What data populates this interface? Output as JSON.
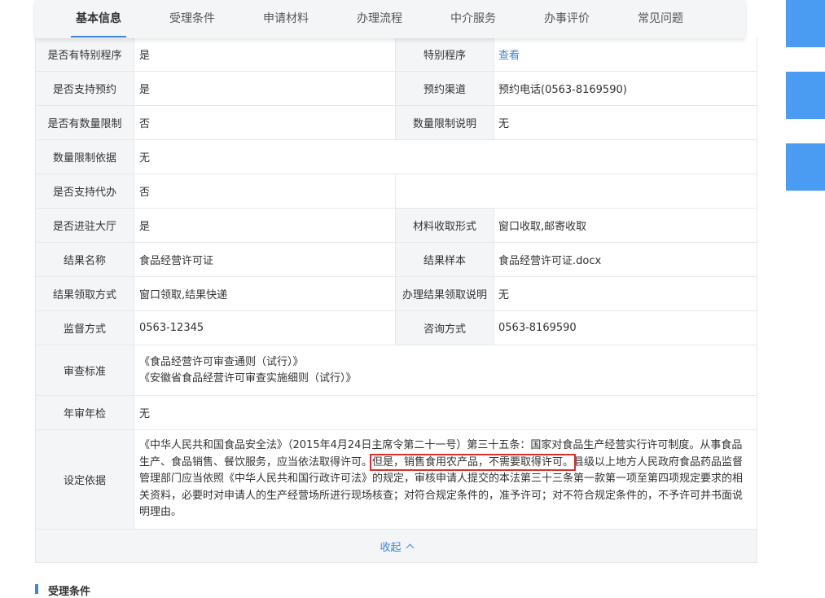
{
  "tabs": [
    "基本信息",
    "受理条件",
    "申请材料",
    "办理流程",
    "中介服务",
    "办事评价",
    "常见问题"
  ],
  "rows": {
    "special_program": {
      "label": "是否有特别程序",
      "value": "是",
      "label2": "特别程序",
      "value2": "查看"
    },
    "reservation": {
      "label": "是否支持预约",
      "value": "是",
      "label2": "预约渠道",
      "value2": "预约电话(0563-8169590)"
    },
    "quantity_limit": {
      "label": "是否有数量限制",
      "value": "否",
      "label2": "数量限制说明",
      "value2": "无"
    },
    "quantity_basis": {
      "label": "数量限制依据",
      "value": "无"
    },
    "proxy": {
      "label": "是否支持代办",
      "value": "否"
    },
    "hall": {
      "label": "是否进驻大厅",
      "value": "是",
      "label2": "材料收取形式",
      "value2": "窗口收取,邮寄收取"
    },
    "result_name": {
      "label": "结果名称",
      "value": "食品经营许可证",
      "label2": "结果样本",
      "value2": "食品经营许可证.docx"
    },
    "result_pickup": {
      "label": "结果领取方式",
      "value": "窗口领取,结果快递",
      "label2": "办理结果领取说明",
      "value2": "无"
    },
    "supervision": {
      "label": "监督方式",
      "value": "0563-12345",
      "label2": "咨询方式",
      "value2": "0563-8169590"
    },
    "review_standard": {
      "label": "审查标准",
      "line1": "《食品经营许可审查通则（试行）》",
      "line2": "《安徽省食品经营许可审查实施细则（试行）》"
    },
    "annual": {
      "label": "年审年检",
      "value": "无"
    },
    "basis": {
      "label": "设定依据",
      "part1": "《中华人民共和国食品安全法》（2015年4月24日主席令第二十一号）第三十五条：国家对食品生产经营实行许可制度。从事食品生产、食品销售、餐饮服务，应当依法取得许可。",
      "highlight": "但是，销售食用农产品，不需要取得许可。",
      "part2": "县级以上地方人民政府食品药品监督管理部门应当依照《中华人民共和国行政许可法》的规定，审核申请人提交的本法第三十三条第一款第一项至第四项规定要求的相关资料，必要时对申请人的生产经营场所进行现场核查；对符合规定条件的，准予许可；对不符合规定条件的，不予许可并书面说明理由。"
    }
  },
  "collapse_label": "收起",
  "next_section_title": "受理条件",
  "colors": {
    "accent": "#3b86e0",
    "side_block": "#4a9cf2",
    "highlight_border": "#d9302c"
  }
}
